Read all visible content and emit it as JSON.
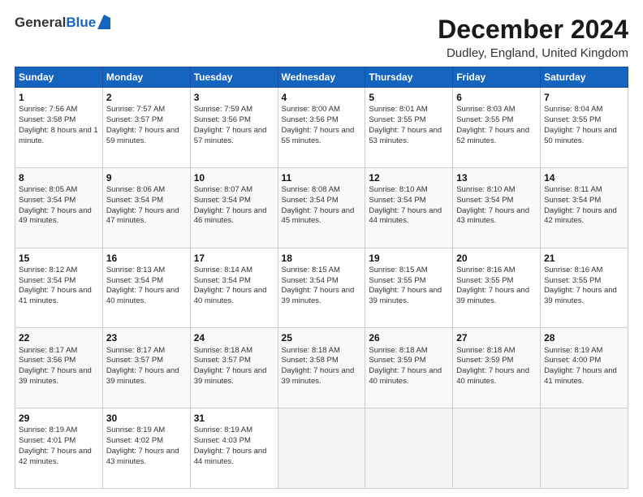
{
  "header": {
    "logo_general": "General",
    "logo_blue": "Blue",
    "month_title": "December 2024",
    "location": "Dudley, England, United Kingdom"
  },
  "days_of_week": [
    "Sunday",
    "Monday",
    "Tuesday",
    "Wednesday",
    "Thursday",
    "Friday",
    "Saturday"
  ],
  "weeks": [
    [
      {
        "day": "1",
        "sunrise": "Sunrise: 7:56 AM",
        "sunset": "Sunset: 3:58 PM",
        "daylight": "Daylight: 8 hours and 1 minute."
      },
      {
        "day": "2",
        "sunrise": "Sunrise: 7:57 AM",
        "sunset": "Sunset: 3:57 PM",
        "daylight": "Daylight: 7 hours and 59 minutes."
      },
      {
        "day": "3",
        "sunrise": "Sunrise: 7:59 AM",
        "sunset": "Sunset: 3:56 PM",
        "daylight": "Daylight: 7 hours and 57 minutes."
      },
      {
        "day": "4",
        "sunrise": "Sunrise: 8:00 AM",
        "sunset": "Sunset: 3:56 PM",
        "daylight": "Daylight: 7 hours and 55 minutes."
      },
      {
        "day": "5",
        "sunrise": "Sunrise: 8:01 AM",
        "sunset": "Sunset: 3:55 PM",
        "daylight": "Daylight: 7 hours and 53 minutes."
      },
      {
        "day": "6",
        "sunrise": "Sunrise: 8:03 AM",
        "sunset": "Sunset: 3:55 PM",
        "daylight": "Daylight: 7 hours and 52 minutes."
      },
      {
        "day": "7",
        "sunrise": "Sunrise: 8:04 AM",
        "sunset": "Sunset: 3:55 PM",
        "daylight": "Daylight: 7 hours and 50 minutes."
      }
    ],
    [
      {
        "day": "8",
        "sunrise": "Sunrise: 8:05 AM",
        "sunset": "Sunset: 3:54 PM",
        "daylight": "Daylight: 7 hours and 49 minutes."
      },
      {
        "day": "9",
        "sunrise": "Sunrise: 8:06 AM",
        "sunset": "Sunset: 3:54 PM",
        "daylight": "Daylight: 7 hours and 47 minutes."
      },
      {
        "day": "10",
        "sunrise": "Sunrise: 8:07 AM",
        "sunset": "Sunset: 3:54 PM",
        "daylight": "Daylight: 7 hours and 46 minutes."
      },
      {
        "day": "11",
        "sunrise": "Sunrise: 8:08 AM",
        "sunset": "Sunset: 3:54 PM",
        "daylight": "Daylight: 7 hours and 45 minutes."
      },
      {
        "day": "12",
        "sunrise": "Sunrise: 8:10 AM",
        "sunset": "Sunset: 3:54 PM",
        "daylight": "Daylight: 7 hours and 44 minutes."
      },
      {
        "day": "13",
        "sunrise": "Sunrise: 8:10 AM",
        "sunset": "Sunset: 3:54 PM",
        "daylight": "Daylight: 7 hours and 43 minutes."
      },
      {
        "day": "14",
        "sunrise": "Sunrise: 8:11 AM",
        "sunset": "Sunset: 3:54 PM",
        "daylight": "Daylight: 7 hours and 42 minutes."
      }
    ],
    [
      {
        "day": "15",
        "sunrise": "Sunrise: 8:12 AM",
        "sunset": "Sunset: 3:54 PM",
        "daylight": "Daylight: 7 hours and 41 minutes."
      },
      {
        "day": "16",
        "sunrise": "Sunrise: 8:13 AM",
        "sunset": "Sunset: 3:54 PM",
        "daylight": "Daylight: 7 hours and 40 minutes."
      },
      {
        "day": "17",
        "sunrise": "Sunrise: 8:14 AM",
        "sunset": "Sunset: 3:54 PM",
        "daylight": "Daylight: 7 hours and 40 minutes."
      },
      {
        "day": "18",
        "sunrise": "Sunrise: 8:15 AM",
        "sunset": "Sunset: 3:54 PM",
        "daylight": "Daylight: 7 hours and 39 minutes."
      },
      {
        "day": "19",
        "sunrise": "Sunrise: 8:15 AM",
        "sunset": "Sunset: 3:55 PM",
        "daylight": "Daylight: 7 hours and 39 minutes."
      },
      {
        "day": "20",
        "sunrise": "Sunrise: 8:16 AM",
        "sunset": "Sunset: 3:55 PM",
        "daylight": "Daylight: 7 hours and 39 minutes."
      },
      {
        "day": "21",
        "sunrise": "Sunrise: 8:16 AM",
        "sunset": "Sunset: 3:55 PM",
        "daylight": "Daylight: 7 hours and 39 minutes."
      }
    ],
    [
      {
        "day": "22",
        "sunrise": "Sunrise: 8:17 AM",
        "sunset": "Sunset: 3:56 PM",
        "daylight": "Daylight: 7 hours and 39 minutes."
      },
      {
        "day": "23",
        "sunrise": "Sunrise: 8:17 AM",
        "sunset": "Sunset: 3:57 PM",
        "daylight": "Daylight: 7 hours and 39 minutes."
      },
      {
        "day": "24",
        "sunrise": "Sunrise: 8:18 AM",
        "sunset": "Sunset: 3:57 PM",
        "daylight": "Daylight: 7 hours and 39 minutes."
      },
      {
        "day": "25",
        "sunrise": "Sunrise: 8:18 AM",
        "sunset": "Sunset: 3:58 PM",
        "daylight": "Daylight: 7 hours and 39 minutes."
      },
      {
        "day": "26",
        "sunrise": "Sunrise: 8:18 AM",
        "sunset": "Sunset: 3:59 PM",
        "daylight": "Daylight: 7 hours and 40 minutes."
      },
      {
        "day": "27",
        "sunrise": "Sunrise: 8:18 AM",
        "sunset": "Sunset: 3:59 PM",
        "daylight": "Daylight: 7 hours and 40 minutes."
      },
      {
        "day": "28",
        "sunrise": "Sunrise: 8:19 AM",
        "sunset": "Sunset: 4:00 PM",
        "daylight": "Daylight: 7 hours and 41 minutes."
      }
    ],
    [
      {
        "day": "29",
        "sunrise": "Sunrise: 8:19 AM",
        "sunset": "Sunset: 4:01 PM",
        "daylight": "Daylight: 7 hours and 42 minutes."
      },
      {
        "day": "30",
        "sunrise": "Sunrise: 8:19 AM",
        "sunset": "Sunset: 4:02 PM",
        "daylight": "Daylight: 7 hours and 43 minutes."
      },
      {
        "day": "31",
        "sunrise": "Sunrise: 8:19 AM",
        "sunset": "Sunset: 4:03 PM",
        "daylight": "Daylight: 7 hours and 44 minutes."
      },
      null,
      null,
      null,
      null
    ]
  ]
}
